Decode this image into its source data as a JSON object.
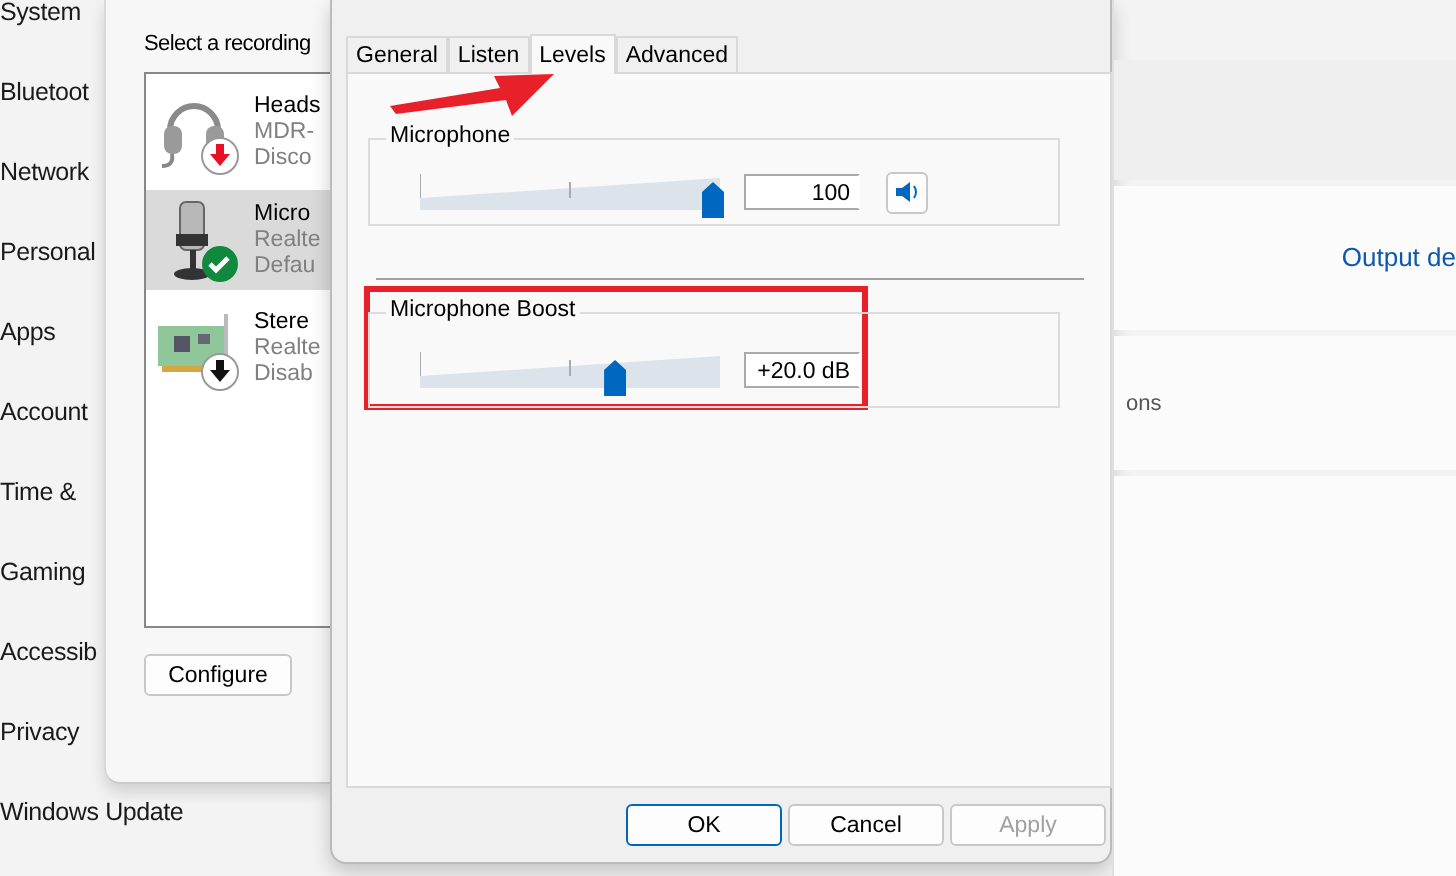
{
  "settings_sidebar": {
    "items": [
      {
        "label": "System"
      },
      {
        "label": "Bluetoot"
      },
      {
        "label": "Network"
      },
      {
        "label": "Personal"
      },
      {
        "label": "Apps"
      },
      {
        "label": "Account"
      },
      {
        "label": "Time & "
      },
      {
        "label": "Gaming"
      },
      {
        "label": "Accessib"
      },
      {
        "label": "Privacy"
      },
      {
        "label": "Windows Update"
      }
    ]
  },
  "sound_window": {
    "prompt": "Select a recording",
    "devices": [
      {
        "kind": "headset",
        "default": false,
        "color": "#e81123",
        "name": "Heads",
        "detail": "MDR-",
        "status": "Disco",
        "selected": false
      },
      {
        "kind": "microphone",
        "default": true,
        "color": "#10893e",
        "name": "Micro",
        "detail": "Realte",
        "status": "Defau",
        "selected": true
      },
      {
        "kind": "card",
        "default": false,
        "color": "#111111",
        "name": "Stere",
        "detail": "Realte",
        "status": "Disab",
        "selected": false
      }
    ],
    "configure_button": "Configure"
  },
  "properties_window": {
    "tabs": [
      {
        "label": "General",
        "selected": false
      },
      {
        "label": "Listen",
        "selected": false
      },
      {
        "label": "Levels",
        "selected": true
      },
      {
        "label": "Advanced",
        "selected": false
      }
    ],
    "levels": [
      {
        "label": "Microphone",
        "level": 1,
        "reading": "100",
        "mute_button": true,
        "highlighted": false
      },
      {
        "label": "Microphone Boost",
        "level": 0.66,
        "reading": "+20.0 dB",
        "mute_button": false,
        "highlighted": true
      }
    ],
    "buttons": [
      {
        "label": "OK",
        "default": true,
        "disabled": false
      },
      {
        "label": "Cancel",
        "default": false,
        "disabled": false
      },
      {
        "label": "Apply",
        "default": false,
        "disabled": true
      }
    ]
  },
  "settings_content": {
    "link": "Output de",
    "text": "ons"
  }
}
